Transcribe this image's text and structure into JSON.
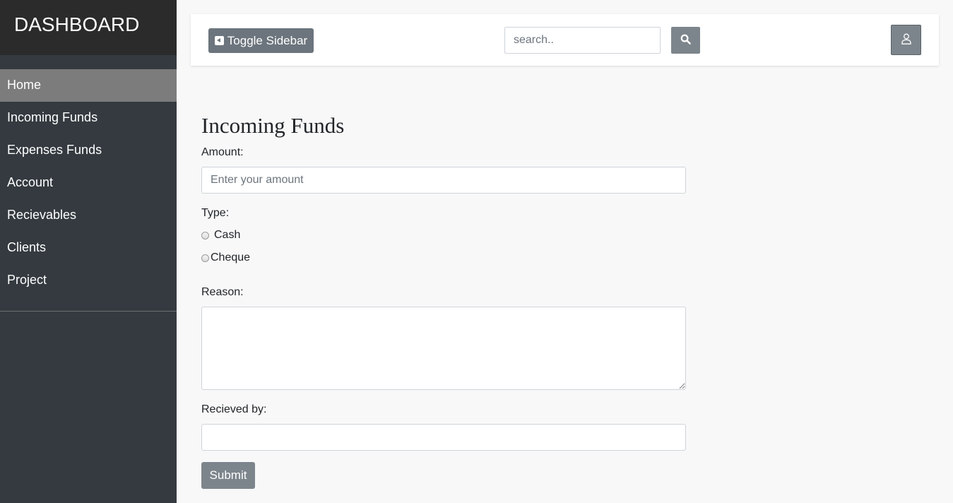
{
  "sidebar": {
    "brand": "DASHBOARD",
    "items": [
      {
        "label": "Home"
      },
      {
        "label": "Incoming Funds"
      },
      {
        "label": "Expenses Funds"
      },
      {
        "label": "Account"
      },
      {
        "label": "Recievables"
      },
      {
        "label": "Clients"
      },
      {
        "label": "Project"
      }
    ],
    "active_index": 0
  },
  "topbar": {
    "toggle_label": "Toggle Sidebar",
    "search_placeholder": "search..",
    "search_value": ""
  },
  "form": {
    "title": "Incoming Funds",
    "amount_label": "Amount:",
    "amount_placeholder": "Enter your amount",
    "type_label": "Type:",
    "type_options": [
      "Cash",
      "Cheque"
    ],
    "reason_label": "Reason:",
    "received_label": "Recieved by:",
    "submit_label": "Submit"
  },
  "colors": {
    "sidebar_bg": "#343a40",
    "brand_bg": "#2b2b2b",
    "active_item_bg": "#7c7c7c",
    "button_bg": "#6c757d"
  },
  "icons": {
    "toggle": "caret-square-left-icon",
    "search": "search-icon",
    "user": "user-icon"
  }
}
